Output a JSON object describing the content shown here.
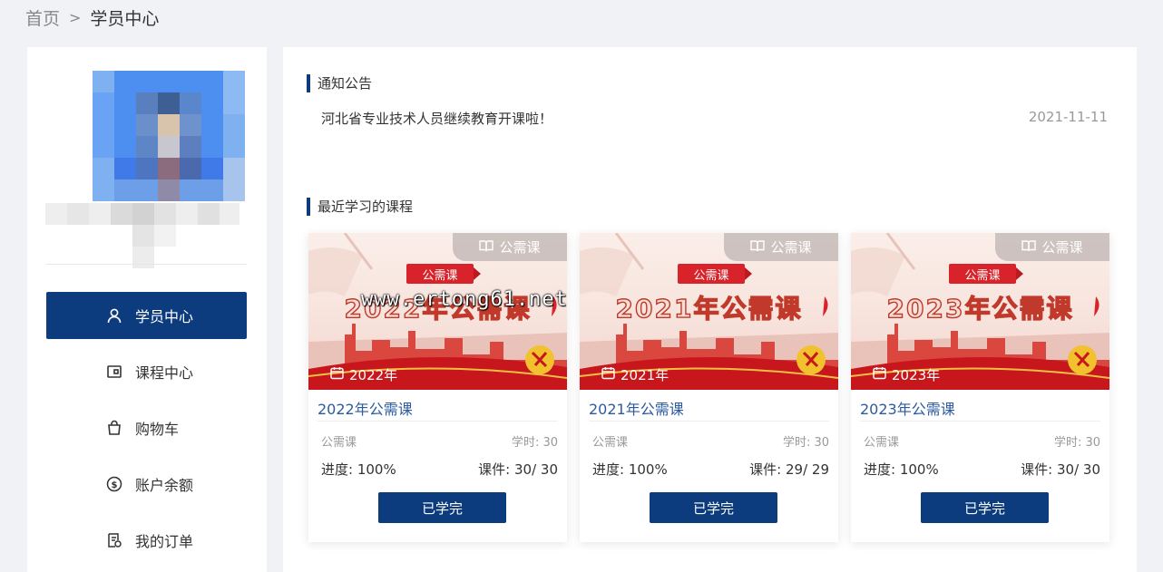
{
  "breadcrumb": {
    "home": "首页",
    "separator": ">",
    "current": "学员中心"
  },
  "sidebar": {
    "items": [
      {
        "label": "学员中心",
        "icon": "user-icon",
        "active": true
      },
      {
        "label": "课程中心",
        "icon": "course-icon",
        "active": false
      },
      {
        "label": "购物车",
        "icon": "shopping-bag-icon",
        "active": false
      },
      {
        "label": "账户余额",
        "icon": "dollar-circle-icon",
        "active": false
      },
      {
        "label": "我的订单",
        "icon": "order-icon",
        "active": false
      }
    ]
  },
  "notice": {
    "section_title": "通知公告",
    "items": [
      {
        "text": "河北省专业技术人员继续教育开课啦！",
        "date": "2021-11-11"
      }
    ]
  },
  "recent": {
    "section_title": "最近学习的课程",
    "cards": [
      {
        "tag": "公需课",
        "ribbon": "公需课",
        "banner_title": "2022年公需课",
        "year": "2022年",
        "title": "2022年公需课",
        "category": "公需课",
        "hours": "学时: 30",
        "progress": "进度: 100%",
        "files": "课件: 30/ 30",
        "button": "已学完"
      },
      {
        "tag": "公需课",
        "ribbon": "公需课",
        "banner_title": "2021年公需课",
        "year": "2021年",
        "title": "2021年公需课",
        "category": "公需课",
        "hours": "学时: 30",
        "progress": "进度: 100%",
        "files": "课件: 29/ 29",
        "button": "已学完"
      },
      {
        "tag": "公需课",
        "ribbon": "公需课",
        "banner_title": "2023年公需课",
        "year": "2023年",
        "title": "2023年公需课",
        "category": "公需课",
        "hours": "学时: 30",
        "progress": "进度: 100%",
        "files": "课件: 30/ 30",
        "button": "已学完"
      }
    ]
  },
  "watermark": "www.ertong61.net",
  "colors": {
    "primary": "#0d3c7e",
    "link": "#2c5aa0",
    "banner_red": "#d8232a"
  }
}
